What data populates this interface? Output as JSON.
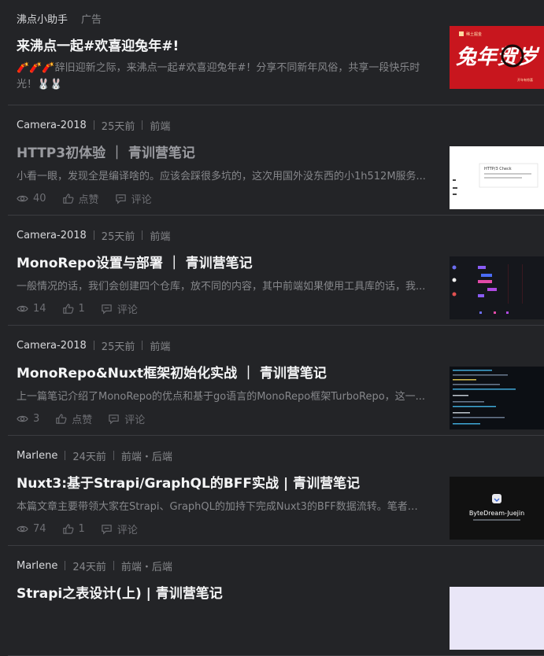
{
  "feed": [
    {
      "author": "沸点小助手",
      "badge": "广告",
      "title": "来沸点一起#欢喜迎兔年#!",
      "icons_prefix": "🧨🧨🧨",
      "abstract": "辞旧迎新之际，来沸点一起#欢喜迎兔年#！分享不同新年风俗，共享一段快乐时光！",
      "icons_suffix": "🐰🐰",
      "thumb": {
        "text": "兔年贺岁",
        "brand": "稀土掘金",
        "sub": "开年有惊喜"
      }
    },
    {
      "author": "Camera-2018",
      "time": "25天前",
      "tags": "前端",
      "title": "HTTP3初体验 ｜ 青训营笔记",
      "abstract": "小看一眼，发现全是编译啥的。应该会踩很多坑的，这次用国外没东西的小1h512M服务...",
      "views": "40",
      "likes": "点赞",
      "comments": "评论",
      "thumb": {
        "title": "HTTP/3 Check"
      }
    },
    {
      "author": "Camera-2018",
      "time": "25天前",
      "tags": "前端",
      "title": "MonoRepo设置与部署 ｜ 青训营笔记",
      "abstract": "一般情况的话，我们会创建四个仓库，放不同的内容，其中前端如果使用工具库的话，我...",
      "views": "14",
      "likes": "1",
      "comments": "评论"
    },
    {
      "author": "Camera-2018",
      "time": "25天前",
      "tags": "前端",
      "title": "MonoRepo&Nuxt框架初始化实战 ｜ 青训营笔记",
      "abstract": "上一篇笔记介绍了MonoRepo的优点和基于go语言的MonoRepo框架TurboRepo，这一...",
      "views": "3",
      "likes": "点赞",
      "comments": "评论"
    },
    {
      "author": "Marlene",
      "time": "24天前",
      "tags": "前端・后端",
      "title": "Nuxt3:基于Strapi/GraphQL的BFF实战 | 青训营笔记",
      "abstract": "本篇文章主要带领大家在Strapi、GraphQL的加持下完成Nuxt3的BFF数据流转。笔者在...",
      "views": "74",
      "likes": "1",
      "comments": "评论",
      "thumb": {
        "text": "ByteDream-Juejin"
      }
    },
    {
      "author": "Marlene",
      "time": "24天前",
      "tags": "前端・后端",
      "title": "Strapi之表设计(上) | 青训营笔记"
    }
  ],
  "colors": {
    "background": "#232427",
    "title": "#f4f5f6",
    "muted": "#86878b",
    "ad_red": "#c8161e"
  }
}
